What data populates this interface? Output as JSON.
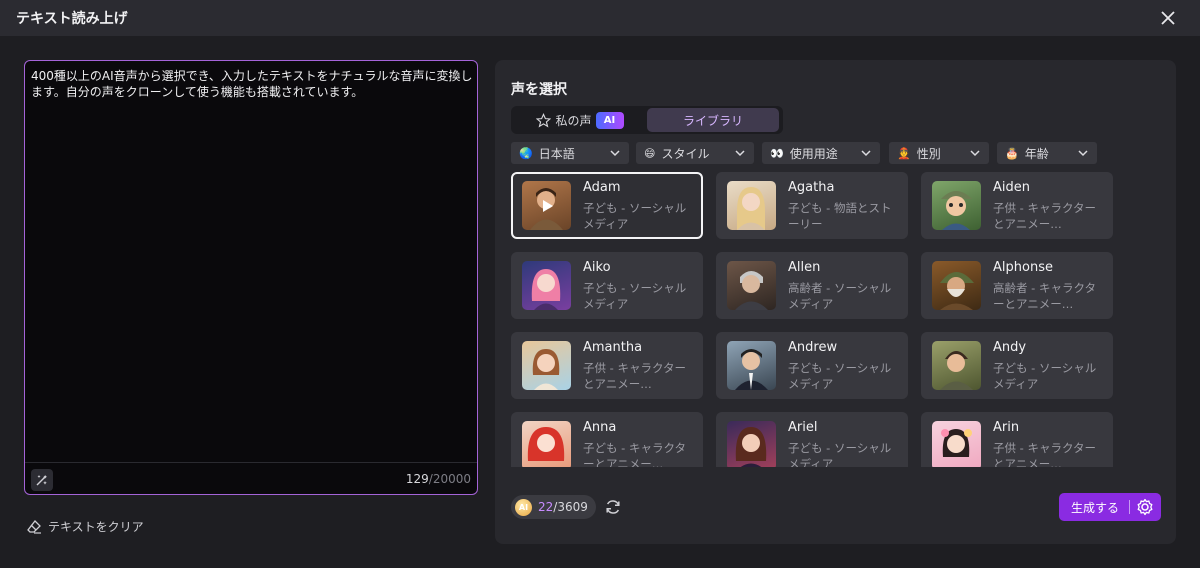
{
  "window": {
    "title": "テキスト読み上げ"
  },
  "editor": {
    "text": "400種以上のAI音声から選択でき、入力したテキストをナチュラルな音声に変換します。自分の声をクローンして使う機能も搭載されています。",
    "char_count": "129",
    "char_max": "/20000"
  },
  "clear_label": "テキストをクリア",
  "panel": {
    "heading": "声を選択",
    "tabs": {
      "mine": "私の声",
      "ai_badge": "AI",
      "library": "ライブラリ"
    },
    "filters": [
      {
        "emoji": "🌏",
        "label": "日本語",
        "icon": "globe-icon"
      },
      {
        "emoji": "😄",
        "label": "スタイル",
        "icon": "smile-icon"
      },
      {
        "emoji": "👀",
        "label": "使用用途",
        "icon": "eyes-icon"
      },
      {
        "emoji": "👲",
        "label": "性別",
        "icon": "person-icon"
      },
      {
        "emoji": "🎂",
        "label": "年齢",
        "icon": "cake-icon"
      }
    ],
    "voices": [
      {
        "name": "Adam",
        "desc": "子ども - ソーシャルメディア",
        "selected": true
      },
      {
        "name": "Agatha",
        "desc": "子ども - 物語とストーリー"
      },
      {
        "name": "Aiden",
        "desc": "子供 - キャラクターとアニメー…"
      },
      {
        "name": "Aiko",
        "desc": "子ども - ソーシャルメディア"
      },
      {
        "name": "Allen",
        "desc": "高齢者 - ソーシャルメディア"
      },
      {
        "name": "Alphonse",
        "desc": "高齢者 - キャラクターとアニメー…"
      },
      {
        "name": "Amantha",
        "desc": "子供 - キャラクターとアニメー…"
      },
      {
        "name": "Andrew",
        "desc": "子ども - ソーシャルメディア"
      },
      {
        "name": "Andy",
        "desc": "子ども - ソーシャルメディア"
      },
      {
        "name": "Anna",
        "desc": "子ども - キャラクターとアニメー…"
      },
      {
        "name": "Ariel",
        "desc": "子ども - ソーシャルメディア"
      },
      {
        "name": "Arin",
        "desc": "子供 - キャラクターとアニメー…"
      }
    ],
    "credits": {
      "coin": "AI",
      "used": "22",
      "total": "/3609"
    },
    "generate_label": "生成する"
  },
  "colors": {
    "accent": "#8a2be2",
    "editor_border": "#a463d8",
    "panel_bg": "#28282d"
  }
}
